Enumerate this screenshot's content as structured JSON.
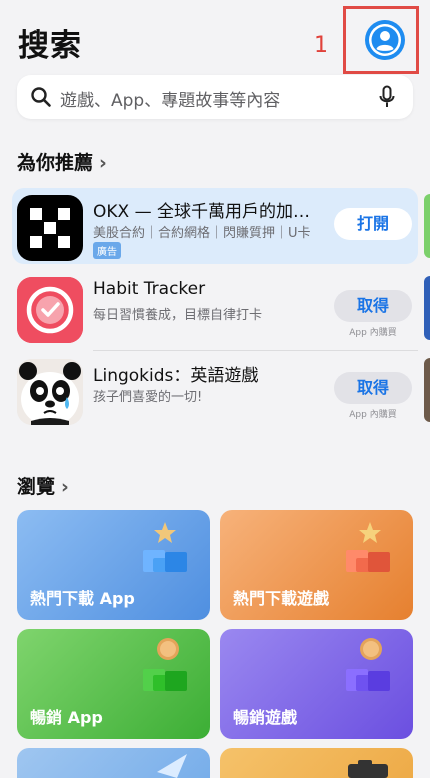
{
  "header": {
    "title": "搜索",
    "annotation_number": "1"
  },
  "search": {
    "placeholder": "遊戲、App、專題故事等內容"
  },
  "recommend": {
    "title": "為你推薦",
    "apps": [
      {
        "name": "OKX — 全球千萬用戶的加…",
        "subtitle": "美股合約｜合約網格｜閃賺質押｜U卡",
        "badge": "廣告",
        "button": "打開",
        "in_app": ""
      },
      {
        "name": "Habit Tracker",
        "subtitle": "每日習慣養成，目標自律打卡",
        "badge": "",
        "button": "取得",
        "in_app": "App 內購買"
      },
      {
        "name": "Lingokids：英語遊戲",
        "subtitle": "孩子們喜愛的一切!",
        "badge": "",
        "button": "取得",
        "in_app": "App 內購買"
      }
    ]
  },
  "browse": {
    "title": "瀏覽",
    "cards": [
      {
        "label": "熱門下載 App",
        "color": "#5b9be6"
      },
      {
        "label": "熱門下載遊戲",
        "color": "#ec8d45"
      },
      {
        "label": "暢銷 App",
        "color": "#4fc04a"
      },
      {
        "label": "暢銷遊戲",
        "color": "#7b61e8"
      }
    ]
  },
  "colors": {
    "accent": "#1a74e6",
    "annotation": "#e0413a"
  }
}
